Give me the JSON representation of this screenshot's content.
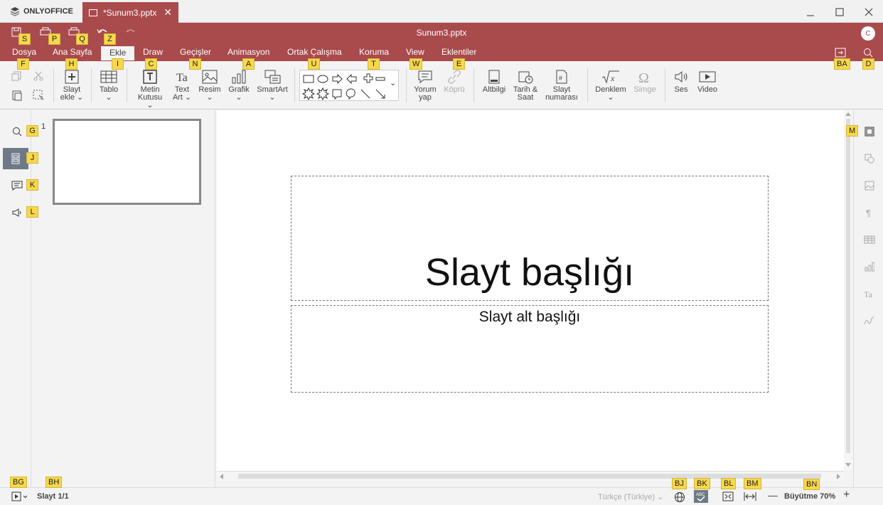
{
  "app": {
    "brand": "ONLYOFFICE",
    "tab_title": "*Sunum3.pptx",
    "doc_title": "Sunum3.pptx",
    "avatar_initial": "C"
  },
  "colors": {
    "accent": "#a94a4c",
    "badge": "#f7d84a"
  },
  "menu": {
    "dosya": "Dosya",
    "ana_sayfa": "Ana Sayfa",
    "ekle": "Ekle",
    "draw": "Draw",
    "gecisler": "Geçişler",
    "animasyon": "Animasyon",
    "ortak": "Ortak Çalışma",
    "koruma": "Koruma",
    "view": "View",
    "eklentiler": "Eklentiler"
  },
  "toolbar": {
    "slayt_ekle": [
      "Slayt",
      "ekle"
    ],
    "tablo": "Tablo",
    "metin_kutusu": [
      "Metin",
      "Kutusu"
    ],
    "text_art": [
      "Text",
      "Art"
    ],
    "resim": "Resim",
    "grafik": "Grafik",
    "smartart": "SmartArt",
    "yorum": [
      "Yorum",
      "yap"
    ],
    "kopru": "Köprü",
    "altbilgi": "Altbilgi",
    "tarih": [
      "Tarih &",
      "Saat"
    ],
    "slayt_no": [
      "Slayt",
      "numarası"
    ],
    "denklem": "Denklem",
    "simge": "Simge",
    "ses": "Ses",
    "video": "Video"
  },
  "thumbnails": {
    "number": "1"
  },
  "slide": {
    "title": "Slayt başlığı",
    "subtitle": "Slayt alt başlığı"
  },
  "status": {
    "slide_counter": "Slayt 1/1",
    "language": "Türkçe (Türkiye)",
    "zoom": "Büyütme 70%"
  },
  "hints": {
    "s": "S",
    "p": "P",
    "q": "Q",
    "z": "Z",
    "f": "F",
    "h": "H",
    "i": "I",
    "c": "C",
    "n": "N",
    "a": "A",
    "u": "U",
    "t": "T",
    "w": "W",
    "e": "E",
    "ba": "BA",
    "d": "D",
    "g": "G",
    "j": "J",
    "k": "K",
    "l": "L",
    "m": "M",
    "bg": "BG",
    "bh": "BH",
    "bj": "BJ",
    "bk": "BK",
    "bl": "BL",
    "bm": "BM",
    "bn": "BN"
  }
}
